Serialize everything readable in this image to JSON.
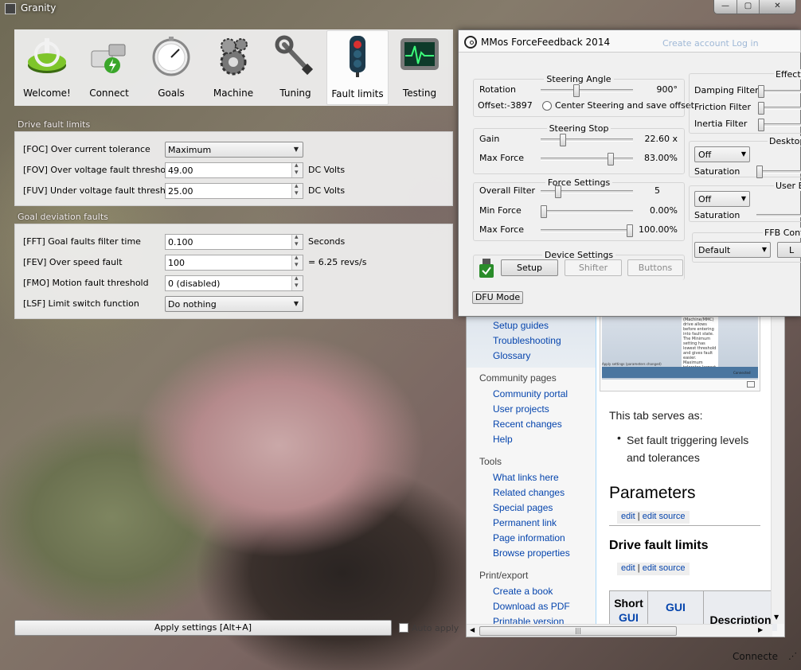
{
  "granity": {
    "title": "Granity",
    "window_buttons": [
      "—",
      "▢",
      "✕"
    ],
    "toolbar": [
      {
        "label": "Welcome!",
        "icon": "power-icon"
      },
      {
        "label": "Connect",
        "icon": "connector-icon"
      },
      {
        "label": "Goals",
        "icon": "gauge-icon"
      },
      {
        "label": "Machine",
        "icon": "gears-icon"
      },
      {
        "label": "Tuning",
        "icon": "wrench-icon"
      },
      {
        "label": "Fault limits",
        "icon": "traffic-light-icon"
      },
      {
        "label": "Testing",
        "icon": "oscilloscope-icon"
      }
    ],
    "drive_fault_limits": {
      "title": "Drive fault limits",
      "rows": [
        {
          "label": "[FOC] Over current tolerance",
          "value": "Maximum",
          "unit": ""
        },
        {
          "label": "[FOV] Over voltage fault threshold",
          "value": "49.00",
          "unit": "DC Volts"
        },
        {
          "label": "[FUV] Under voltage fault threshold",
          "value": "25.00",
          "unit": "DC Volts"
        }
      ]
    },
    "goal_deviation_faults": {
      "title": "Goal deviation faults",
      "rows": [
        {
          "label": "[FFT] Goal faults filter time",
          "value": "0.100",
          "unit": "Seconds"
        },
        {
          "label": "[FEV] Over speed fault",
          "value": "100",
          "unit": "= 6.25 revs/s"
        },
        {
          "label": "[FMO] Motion fault threshold",
          "value": "0 (disabled)",
          "unit": ""
        },
        {
          "label": "[LSF] Limit switch function",
          "value": "Do nothing",
          "unit": ""
        }
      ]
    },
    "apply_label": "Apply settings [Alt+A]",
    "auto_apply_label": "Auto apply",
    "status": "Connecte"
  },
  "mmos": {
    "title": "MMos ForceFeedback 2014",
    "faint_header": "Create account  Log in",
    "steering_angle": {
      "title": "Steering Angle",
      "rotation_label": "Rotation",
      "rotation_value": "900°",
      "rotation_level": 0.38,
      "offset_label": "Offset:-3897",
      "center_label": "Center Steering and save offset"
    },
    "steering_stop": {
      "title": "Steering Stop",
      "gain_label": "Gain",
      "gain_value": "22.60 x",
      "gain_level": 0.22,
      "maxforce_label": "Max Force",
      "maxforce_value": "83.00%",
      "maxforce_level": 0.78
    },
    "force_settings": {
      "title": "Force Settings",
      "overall_label": "Overall Filter",
      "overall_value": "5",
      "overall_level": 0.17,
      "minforce_label": "Min Force",
      "minforce_value": "0.00%",
      "minforce_level": 0.0,
      "maxforce_label": "Max Force",
      "maxforce_value": "100.00%",
      "maxforce_level": 1.0
    },
    "device_settings": {
      "title": "Device Settings",
      "setup": "Setup",
      "shifter": "Shifter",
      "buttons": "Buttons"
    },
    "dfu_mode": "DFU Mode",
    "effect": {
      "title": "Effect F",
      "damping": "Damping Filter",
      "friction": "Friction Filter",
      "inertia": "Inertia Filter"
    },
    "desktop": {
      "title": "Desktop",
      "select": "Off",
      "saturation": "Saturation"
    },
    "user": {
      "title": "User E",
      "select": "Off",
      "saturation": "Saturation"
    },
    "ffb": {
      "title": "FFB Config",
      "select": "Default",
      "button": "L"
    }
  },
  "wiki": {
    "side_links_top": [
      "Setup guides",
      "Troubleshooting",
      "Glossary"
    ],
    "community_title": "Community pages",
    "community_links": [
      "Community portal",
      "User projects",
      "Recent changes",
      "Help"
    ],
    "tools_title": "Tools",
    "tools_links": [
      "What links here",
      "Related changes",
      "Special pages",
      "Permanent link",
      "Page information",
      "Browse properties"
    ],
    "print_title": "Print/export",
    "print_links": [
      "Create a book",
      "Download as PDF",
      "Printable version"
    ],
    "thumb_text": "(Machine/MMC) drive allows before entering into fault state. The Minimum setting has lowest threshold and gives fault easier. Maximum tolerates largest over current spikes before faulting",
    "thumb_status": "Connected",
    "thumb_caption": "Apply settings (parameters changed)",
    "serves_as": "This tab serves as:",
    "bullet": "Set fault triggering levels and tolerances",
    "parameters_heading": "Parameters",
    "edit": "edit",
    "edit_source": "edit source",
    "drive_heading": "Drive fault limits",
    "table_short": "Short",
    "table_gui": "GUI",
    "table_gui2": "GUI",
    "table_description": "Description"
  }
}
